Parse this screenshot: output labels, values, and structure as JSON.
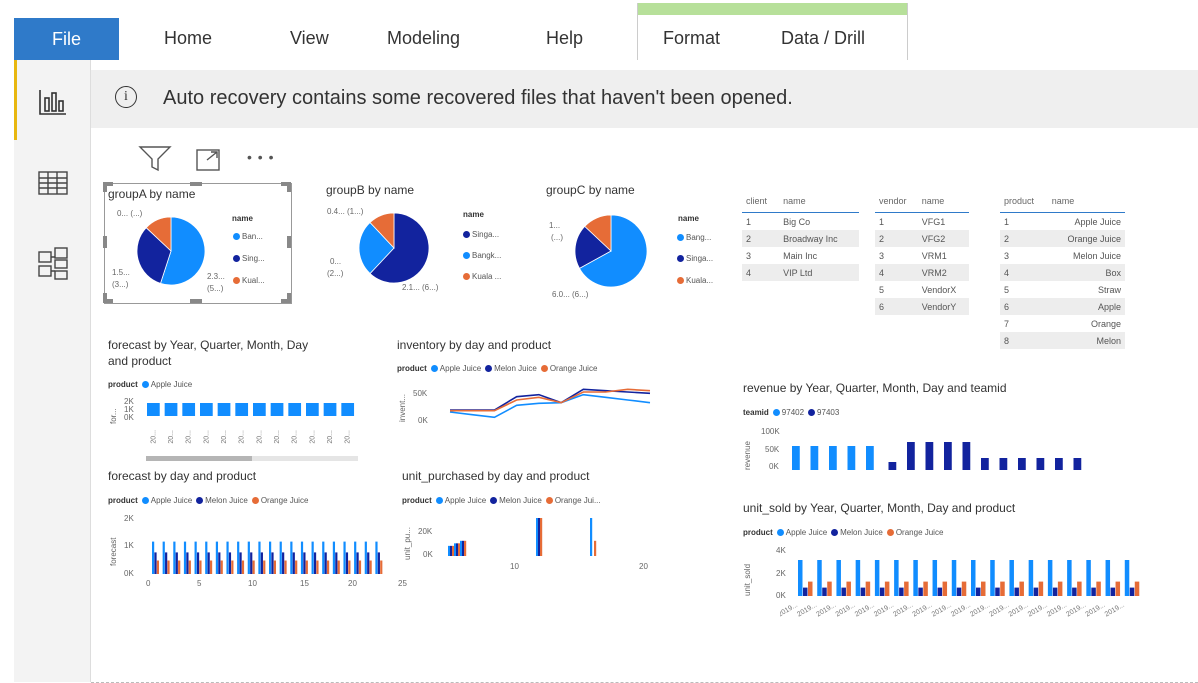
{
  "ribbon": {
    "file": "File",
    "tabs": [
      "Home",
      "View",
      "Modeling",
      "Help",
      "Format",
      "Data / Drill"
    ]
  },
  "notification": {
    "text": "Auto recovery contains some recovered files that haven't been opened."
  },
  "visual_header": {
    "more": "• • •"
  },
  "visuals": {
    "groupA": {
      "title": "groupA by name",
      "legend_title": "name",
      "legend": [
        "Ban...",
        "Sing...",
        "Kual..."
      ],
      "labels": [
        "0... (...)",
        "1.5...",
        "(3...)",
        "2.3...",
        "(5...)"
      ]
    },
    "groupB": {
      "title": "groupB by name",
      "legend_title": "name",
      "legend": [
        "Singa...",
        "Bangk...",
        "Kuala ..."
      ],
      "labels": [
        "0.4... (1...)",
        "0...",
        "(2...)",
        "2.1... (6...)"
      ]
    },
    "groupC": {
      "title": "groupC by name",
      "legend_title": "name",
      "legend": [
        "Bang...",
        "Singa...",
        "Kuala..."
      ],
      "labels": [
        "1...",
        "(...)",
        "6.0... (6...)"
      ]
    },
    "forecast_ymd": {
      "title1": "forecast by Year, Quarter, Month, Day",
      "title2": "and product",
      "legend_title": "product",
      "legend": [
        "Apple Juice"
      ],
      "ylabel": "for...",
      "yticks": [
        "2K",
        "1K",
        "0K"
      ],
      "xtick": "20..."
    },
    "inventory": {
      "title": "inventory by day and product",
      "legend_title": "product",
      "legend": [
        "Apple Juice",
        "Melon Juice",
        "Orange Juice"
      ],
      "ylabel": "invent...",
      "yticks": [
        "50K",
        "0K"
      ]
    },
    "revenue": {
      "title": "revenue by Year, Quarter, Month, Day and teamid",
      "legend_title": "teamid",
      "legend": [
        "97402",
        "97403"
      ],
      "ylabel": "revenue",
      "yticks": [
        "100K",
        "50K",
        "0K"
      ]
    },
    "forecast_day": {
      "title": "forecast by day and product",
      "legend_title": "product",
      "legend": [
        "Apple Juice",
        "Melon Juice",
        "Orange Juice"
      ],
      "ylabel": "forecast",
      "yticks": [
        "2K",
        "1K",
        "0K"
      ],
      "xticks": [
        "0",
        "5",
        "10",
        "15",
        "20",
        "25"
      ]
    },
    "unit_purchased": {
      "title": "unit_purchased by day and product",
      "legend_title": "product",
      "legend": [
        "Apple Juice",
        "Melon Juice",
        "Orange Jui..."
      ],
      "ylabel": "unit_pu...",
      "yticks": [
        "20K",
        "0K"
      ],
      "xticks": [
        "10",
        "20"
      ]
    },
    "unit_sold": {
      "title": "unit_sold by Year, Quarter, Month, Day and product",
      "legend_title": "product",
      "legend": [
        "Apple Juice",
        "Melon Juice",
        "Orange Juice"
      ],
      "ylabel": "unit_sold",
      "yticks": [
        "4K",
        "2K",
        "0K"
      ],
      "xtick": "2019..."
    }
  },
  "tables": {
    "client": {
      "headers": [
        "client",
        "name"
      ],
      "rows": [
        [
          "1",
          "Big Co"
        ],
        [
          "2",
          "Broadway Inc"
        ],
        [
          "3",
          "Main Inc"
        ],
        [
          "4",
          "VIP Ltd"
        ]
      ]
    },
    "vendor": {
      "headers": [
        "vendor",
        "name"
      ],
      "rows": [
        [
          "1",
          "VFG1"
        ],
        [
          "2",
          "VFG2"
        ],
        [
          "3",
          "VRM1"
        ],
        [
          "4",
          "VRM2"
        ],
        [
          "5",
          "VendorX"
        ],
        [
          "6",
          "VendorY"
        ]
      ]
    },
    "product": {
      "headers": [
        "product",
        "name"
      ],
      "rows": [
        [
          "1",
          "Apple Juice"
        ],
        [
          "2",
          "Orange Juice"
        ],
        [
          "3",
          "Melon Juice"
        ],
        [
          "4",
          "Box"
        ],
        [
          "5",
          "Straw"
        ],
        [
          "6",
          "Apple"
        ],
        [
          "7",
          "Orange"
        ],
        [
          "8",
          "Melon"
        ]
      ]
    }
  },
  "colors": {
    "apple": "#118dff",
    "melon": "#12239e",
    "orange": "#e66c37",
    "accent": "#2f7ac9"
  },
  "chart_data": [
    {
      "type": "pie",
      "title": "groupA by name",
      "series": [
        {
          "name": "Ban...",
          "value": 55
        },
        {
          "name": "Sing...",
          "value": 32
        },
        {
          "name": "Kual...",
          "value": 13
        }
      ]
    },
    {
      "type": "pie",
      "title": "groupB by name",
      "series": [
        {
          "name": "Singa...",
          "value": 62
        },
        {
          "name": "Bangk...",
          "value": 26
        },
        {
          "name": "Kuala ...",
          "value": 12
        }
      ]
    },
    {
      "type": "pie",
      "title": "groupC by name",
      "series": [
        {
          "name": "Bang...",
          "value": 67
        },
        {
          "name": "Singa...",
          "value": 20
        },
        {
          "name": "Kuala...",
          "value": 13
        }
      ]
    },
    {
      "type": "bar",
      "title": "forecast by Year, Quarter, Month, Day and product",
      "series": [
        {
          "name": "Apple Juice",
          "values": [
            1000,
            1000,
            1000,
            1000,
            1000,
            1000,
            1000,
            1000,
            1000,
            1000,
            1000,
            1000
          ]
        }
      ],
      "ylim": [
        0,
        2000
      ]
    },
    {
      "type": "line",
      "title": "inventory by day and product",
      "x": [
        1,
        2,
        3,
        4,
        5,
        6,
        7,
        8,
        9,
        10
      ],
      "ylim": [
        0,
        60000
      ],
      "series": [
        {
          "name": "Apple Juice",
          "values": [
            12000,
            8000,
            4000,
            22000,
            25000,
            26000,
            38000,
            34000,
            30000,
            26000
          ]
        },
        {
          "name": "Melon Juice",
          "values": [
            15000,
            15000,
            15000,
            35000,
            38000,
            26000,
            46000,
            44000,
            42000,
            40000
          ]
        },
        {
          "name": "Orange Juice",
          "values": [
            14000,
            14000,
            14000,
            30000,
            34000,
            26000,
            42000,
            42000,
            46000,
            44000
          ]
        }
      ]
    },
    {
      "type": "bar",
      "title": "revenue by Year, Quarter, Month, Day and teamid",
      "ylim": [
        0,
        100000
      ],
      "series": [
        {
          "name": "97402",
          "values": [
            60000,
            60000,
            60000,
            60000,
            60000,
            0,
            0,
            0,
            0,
            0,
            0,
            0,
            0,
            0,
            0,
            0
          ]
        },
        {
          "name": "97403",
          "values": [
            0,
            0,
            0,
            0,
            0,
            20000,
            70000,
            70000,
            70000,
            70000,
            30000,
            30000,
            30000,
            30000,
            30000,
            30000
          ]
        }
      ]
    },
    {
      "type": "bar",
      "title": "forecast by day and product",
      "x": [
        1,
        2,
        3,
        4,
        5,
        6,
        7,
        8,
        9,
        10,
        11,
        12,
        13,
        14,
        15,
        16,
        17,
        18,
        19,
        20,
        21,
        22
      ],
      "ylim": [
        0,
        2000
      ],
      "series": [
        {
          "name": "Apple Juice",
          "values": [
            1200,
            1200,
            1200,
            1200,
            1200,
            1200,
            1200,
            1200,
            1200,
            1200,
            1200,
            1200,
            1200,
            1200,
            1200,
            1200,
            1200,
            1200,
            1200,
            1200,
            1200,
            1200
          ]
        },
        {
          "name": "Melon Juice",
          "values": [
            800,
            800,
            800,
            800,
            800,
            800,
            800,
            800,
            800,
            800,
            800,
            800,
            800,
            800,
            800,
            800,
            800,
            800,
            800,
            800,
            800,
            800
          ]
        },
        {
          "name": "Orange Juice",
          "values": [
            500,
            500,
            500,
            500,
            500,
            500,
            500,
            500,
            500,
            500,
            500,
            500,
            500,
            500,
            500,
            500,
            500,
            500,
            500,
            500,
            500,
            500
          ]
        }
      ]
    },
    {
      "type": "bar",
      "title": "unit_purchased by day and product",
      "x": [
        1,
        2,
        3,
        12,
        17
      ],
      "ylim": [
        0,
        30000
      ],
      "series": [
        {
          "name": "Apple Juice",
          "values": [
            8000,
            10000,
            12000,
            30000,
            30000
          ]
        },
        {
          "name": "Melon Juice",
          "values": [
            8000,
            10000,
            12000,
            30000,
            0
          ]
        },
        {
          "name": "Orange Jui...",
          "values": [
            8000,
            10000,
            12000,
            30000,
            12000
          ]
        }
      ]
    },
    {
      "type": "bar",
      "title": "unit_sold by Year, Quarter, Month, Day and product",
      "ylim": [
        0,
        4000
      ],
      "series": [
        {
          "name": "Apple Juice",
          "values": [
            3000,
            3000,
            3000,
            3000,
            3000,
            3000,
            3000,
            3000,
            3000,
            3000,
            3000,
            3000,
            3000,
            3000,
            3000,
            3000,
            3000,
            3000
          ]
        },
        {
          "name": "Melon Juice",
          "values": [
            700,
            700,
            700,
            700,
            700,
            700,
            700,
            700,
            700,
            700,
            700,
            700,
            700,
            700,
            700,
            700,
            700,
            700
          ]
        },
        {
          "name": "Orange Juice",
          "values": [
            1200,
            1200,
            1200,
            1200,
            1200,
            1200,
            1200,
            1200,
            1200,
            1200,
            1200,
            1200,
            1200,
            1200,
            1200,
            1200,
            1200,
            1200
          ]
        }
      ]
    }
  ]
}
